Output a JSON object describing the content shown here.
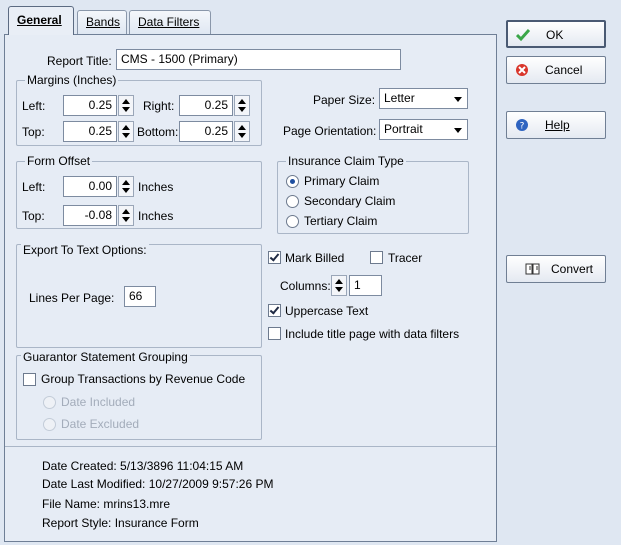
{
  "tabs": [
    {
      "label": "General",
      "active": true
    },
    {
      "label": "Bands",
      "active": false
    },
    {
      "label": "Data Filters",
      "active": false
    }
  ],
  "report_title": {
    "label": "Report Title:",
    "value": "CMS - 1500 (Primary)"
  },
  "margins": {
    "title": "Margins (Inches)",
    "left": {
      "label": "Left:",
      "value": "0.25"
    },
    "right": {
      "label": "Right:",
      "value": "0.25"
    },
    "top": {
      "label": "Top:",
      "value": "0.25"
    },
    "bottom": {
      "label": "Bottom:",
      "value": "0.25"
    }
  },
  "paper_size": {
    "label": "Paper Size:",
    "value": "Letter"
  },
  "page_orientation": {
    "label": "Page Orientation:",
    "value": "Portrait"
  },
  "form_offset": {
    "title": "Form Offset",
    "left": {
      "label": "Left:",
      "value": "0.00",
      "unit": "Inches"
    },
    "top": {
      "label": "Top:",
      "value": "-0.08",
      "unit": "Inches"
    }
  },
  "insurance_claim_type": {
    "title": "Insurance Claim Type",
    "options": [
      "Primary Claim",
      "Secondary Claim",
      "Tertiary Claim"
    ],
    "selected": "Primary Claim"
  },
  "export_options": {
    "title": "Export To Text Options:",
    "lines_per_page": {
      "label": "Lines Per Page:",
      "value": "66"
    }
  },
  "mark_billed": {
    "label": "Mark Billed",
    "checked": true
  },
  "tracer": {
    "label": "Tracer",
    "checked": false
  },
  "columns": {
    "label": "Columns:",
    "value": "1"
  },
  "uppercase_text": {
    "label": "Uppercase Text",
    "checked": true
  },
  "include_title_page": {
    "label": "Include title page with data filters",
    "checked": false
  },
  "guarantor": {
    "title": "Guarantor Statement Grouping",
    "group_by_revenue": {
      "label": "Group Transactions by Revenue Code",
      "checked": false
    },
    "date_included": "Date Included",
    "date_excluded": "Date Excluded"
  },
  "info": {
    "date_created": "Date Created: 5/13/3896 11:04:15 AM",
    "date_modified": "Date Last Modified: 10/27/2009 9:57:26 PM",
    "file_name": "File Name: mrins13.mre",
    "report_style": "Report Style: Insurance Form"
  },
  "buttons": {
    "ok": "OK",
    "cancel": "Cancel",
    "help": "Help",
    "convert": "Convert"
  },
  "colors": {
    "accent": "#1e4fa0",
    "ok_check": "#3aa648",
    "cancel_icon": "#d9362b",
    "help_icon": "#2f64c0"
  }
}
